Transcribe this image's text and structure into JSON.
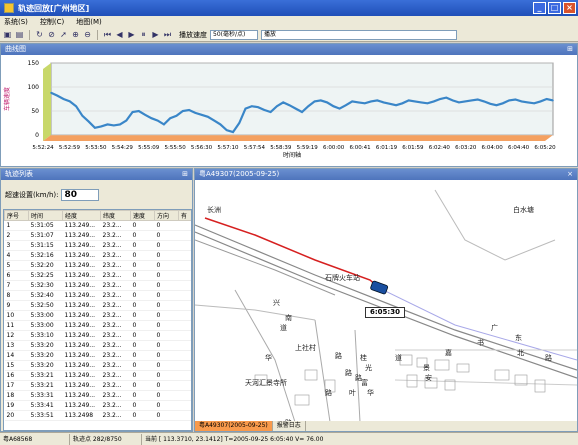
{
  "window": {
    "title": "轨迹回放[广州地区]"
  },
  "menu": {
    "items": [
      "系统(S)",
      "控制(C)",
      "地图(M)"
    ]
  },
  "toolbar": {
    "speed_label": "播放速度",
    "speed_value": "50(毫秒/点)",
    "progress_label": "播放"
  },
  "chart_panel": {
    "title": "曲线图"
  },
  "chart_data": {
    "type": "area",
    "ylabel": "车辆速度",
    "xlabel": "时间轴",
    "ylim": [
      0,
      150
    ],
    "yticks": [
      0,
      50,
      100,
      150
    ],
    "xticks": [
      "5:52:24",
      "5:52:59",
      "5:53:50",
      "5:54:29",
      "5:55:09",
      "5:55:50",
      "5:56:30",
      "5:57:10",
      "5:57:54",
      "5:58:39",
      "5:59:19",
      "6:00:00",
      "6:00:41",
      "6:01:19",
      "6:01:59",
      "6:02:40",
      "6:03:20",
      "6:04:00",
      "6:04:40",
      "6:05:20"
    ],
    "values": [
      88,
      82,
      75,
      70,
      60,
      40,
      28,
      15,
      18,
      22,
      20,
      22,
      30,
      48,
      50,
      42,
      35,
      30,
      22,
      35,
      40,
      50,
      52,
      46,
      42,
      38,
      30,
      22,
      10,
      6,
      25,
      55,
      60,
      58,
      52,
      48,
      60,
      68,
      62,
      55,
      48,
      60,
      70,
      72,
      68,
      60,
      55,
      62,
      70,
      68,
      66,
      70,
      72,
      68,
      65,
      62,
      66,
      72,
      70,
      68,
      66,
      70,
      75,
      78,
      72,
      68,
      70,
      72,
      74,
      70,
      65,
      62,
      66,
      72,
      74,
      70,
      68,
      66,
      70,
      75,
      72
    ]
  },
  "track_panel": {
    "title": "轨迹列表",
    "speed_setting_label": "超速设置(km/h):",
    "speed_setting_value": "80",
    "columns": [
      "序号",
      "时间",
      "经度",
      "纬度",
      "速度",
      "方向",
      "有"
    ],
    "rows": [
      [
        "1",
        "5:31:05",
        "113.249...",
        "23.2...",
        "0",
        "0",
        ""
      ],
      [
        "2",
        "5:31:07",
        "113.249...",
        "23.2...",
        "0",
        "0",
        ""
      ],
      [
        "3",
        "5:31:15",
        "113.249...",
        "23.2...",
        "0",
        "0",
        ""
      ],
      [
        "4",
        "5:32:16",
        "113.249...",
        "23.2...",
        "0",
        "0",
        ""
      ],
      [
        "5",
        "5:32:20",
        "113.249...",
        "23.2...",
        "0",
        "0",
        ""
      ],
      [
        "6",
        "5:32:25",
        "113.249...",
        "23.2...",
        "0",
        "0",
        ""
      ],
      [
        "7",
        "5:32:30",
        "113.249...",
        "23.2...",
        "0",
        "0",
        ""
      ],
      [
        "8",
        "5:32:40",
        "113.249...",
        "23.2...",
        "0",
        "0",
        ""
      ],
      [
        "9",
        "5:32:50",
        "113.249...",
        "23.2...",
        "0",
        "0",
        ""
      ],
      [
        "10",
        "5:33:00",
        "113.249...",
        "23.2...",
        "0",
        "0",
        ""
      ],
      [
        "11",
        "5:33:00",
        "113.249...",
        "23.2...",
        "0",
        "0",
        ""
      ],
      [
        "12",
        "5:33:10",
        "113.249...",
        "23.2...",
        "0",
        "0",
        ""
      ],
      [
        "13",
        "5:33:20",
        "113.249...",
        "23.2...",
        "0",
        "0",
        ""
      ],
      [
        "14",
        "5:33:20",
        "113.249...",
        "23.2...",
        "0",
        "0",
        ""
      ],
      [
        "15",
        "5:33:20",
        "113.249...",
        "23.2...",
        "0",
        "0",
        ""
      ],
      [
        "16",
        "5:33:21",
        "113.249...",
        "23.2...",
        "0",
        "0",
        ""
      ],
      [
        "17",
        "5:33:21",
        "113.249...",
        "23.2...",
        "0",
        "0",
        ""
      ],
      [
        "18",
        "5:33:31",
        "113.249...",
        "23.2...",
        "0",
        "0",
        ""
      ],
      [
        "19",
        "5:33:41",
        "113.249...",
        "23.2...",
        "0",
        "0",
        ""
      ],
      [
        "20",
        "5:33:51",
        "113.2498",
        "23.2...",
        "0",
        "0",
        ""
      ]
    ]
  },
  "map_panel": {
    "title": "粤A49307(2005-09-25)",
    "time_popup": "6:05:30",
    "tabs": [
      "粤A49307(2005-09-25)",
      "报警日志"
    ],
    "labels": [
      "长洲",
      "白水塘",
      "石牌火车站",
      "上社村",
      "天河汇景寺所",
      "华",
      "路",
      "兴",
      "南",
      "道",
      "路",
      "广",
      "东",
      "嘉",
      "书",
      "北",
      "道",
      "景",
      "安",
      "路",
      "桂",
      "富",
      "华",
      "路",
      "光",
      "路",
      "叶",
      "路"
    ]
  },
  "statusbar": {
    "vehicle": "粤A68568",
    "track_points": "轨迹点 282/8750",
    "current": "当前 [ 113.3710, 23.1412] T=2005-09-25 6:05:40 V= 76.00"
  },
  "colors": {
    "accent": "#1f4fb8",
    "line": "#3a86c8",
    "track": "#d62020"
  }
}
